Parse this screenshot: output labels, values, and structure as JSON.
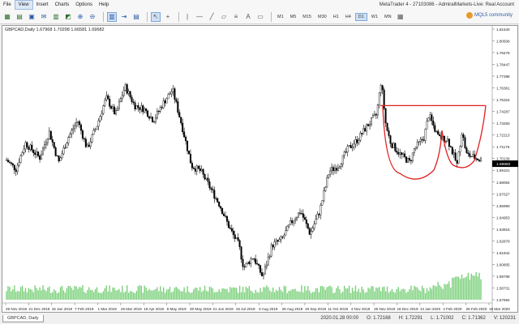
{
  "window": {
    "title": "MetaTrader 4 - 27103086 - AdmiralMarkets-Live: Real Account"
  },
  "menu": [
    "File",
    "View",
    "Insert",
    "Charts",
    "Options",
    "Help"
  ],
  "toolbar": {
    "timeframes": [
      "M1",
      "M5",
      "M15",
      "M30",
      "H1",
      "H4",
      "D1",
      "W1",
      "MN"
    ],
    "selected_timeframe": "D1",
    "mql5_label": "MQL5 community"
  },
  "chart": {
    "info": "GBPCAD,Daily  1.67968 1.70298 1.66581 1.69682",
    "current_price": "1.69682",
    "price_labels": [
      "1.81540",
      "1.80509",
      "1.79478",
      "1.78447",
      "1.77398",
      "1.76361",
      "1.75324",
      "1.74287",
      "1.73250",
      "1.72213",
      "1.71176",
      "1.70139",
      "1.69101",
      "1.68064",
      "1.67027",
      "1.65990",
      "1.64953",
      "1.63916",
      "1.62879",
      "1.61842",
      "1.60805",
      "1.59768",
      "1.58731",
      "1.57694"
    ],
    "date_labels": [
      "29 Nov 2018",
      "21 Dec 2018",
      "16 Jan 2019",
      "7 Feb 2019",
      "1 Mar 2019",
      "25 Mar 2019",
      "18 Apr 2019",
      "8 May 2019",
      "30 May 2019",
      "21 Jun 2019",
      "15 Jul 2019",
      "6 Aug 2019",
      "28 Aug 2019",
      "19 Sep 2019",
      "11 Oct 2019",
      "4 Nov 2019",
      "26 Nov 2019",
      "18 Dec 2019",
      "13 Jan 2020",
      "4 Feb 2020",
      "26 Feb 2020",
      "19 Mar 2020"
    ],
    "colors": {
      "candle": "#000000",
      "volume": "#7bd07b",
      "pattern": "#e02020",
      "current_price_box": "#000000"
    }
  },
  "status": {
    "tab_label": "GBPCAD, Daily",
    "datetime": "2020.01.28 00:00",
    "open": "O: 1.72168",
    "high": "H: 1.72291",
    "low": "L: 1.71002",
    "close": "C: 1.71362",
    "volume": "V: 120231"
  }
}
